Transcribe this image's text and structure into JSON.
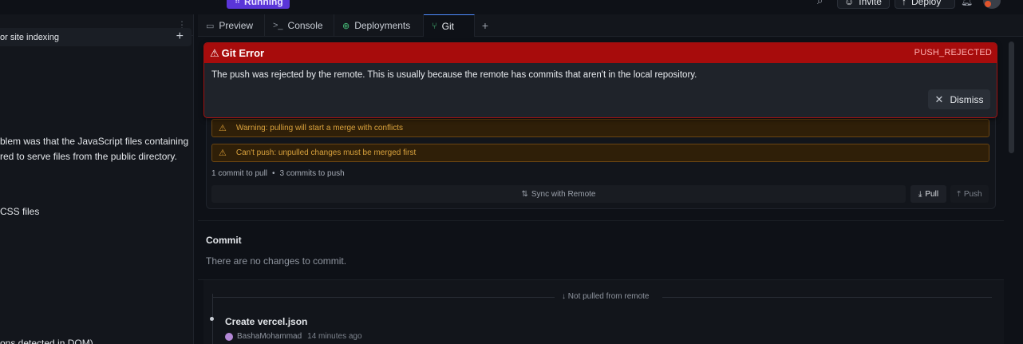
{
  "topbar": {
    "status_badge": "Running",
    "invite_label": "Invite",
    "deploy_label": "Deploy"
  },
  "sidebar": {
    "task_title": "or site indexing",
    "lines": [
      "blem was that the JavaScript files containing",
      "red to serve files from the public directory.",
      "CSS files",
      "ons detected in DOM)"
    ]
  },
  "tabs": [
    {
      "label": "Preview",
      "icon": "monitor-icon"
    },
    {
      "label": "Console",
      "icon": "terminal-icon"
    },
    {
      "label": "Deployments",
      "icon": "globe-icon"
    },
    {
      "label": "Git",
      "icon": "git-branch-icon",
      "active": true
    }
  ],
  "error": {
    "title": "Git Error",
    "code": "PUSH_REJECTED",
    "message": "The push was rejected by the remote. This is usually because the remote has commits that aren't in the local repository.",
    "dismiss_label": "Dismiss",
    "color": "#a70c0c"
  },
  "sync": {
    "warning_1": "Warning: pulling will start a merge with conflicts",
    "warning_2": "Can't push: unpulled changes must be merged first",
    "to_pull": "1 commit to pull",
    "to_push": "3 commits to push",
    "sync_label": "Sync with Remote",
    "pull_label": "Pull",
    "push_label": "Push"
  },
  "commit": {
    "title": "Commit",
    "empty_text": "There are no changes to commit."
  },
  "history": {
    "remote_label": "Not pulled from remote",
    "entries": [
      {
        "message": "Create vercel.json",
        "author": "BashaMohammad",
        "time": "14 minutes ago"
      }
    ]
  }
}
